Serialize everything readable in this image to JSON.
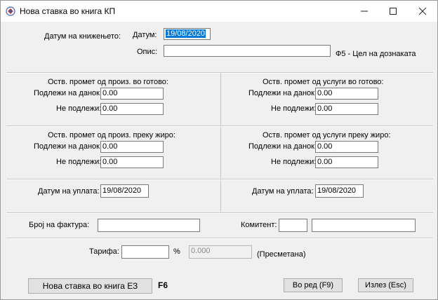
{
  "window": {
    "title": "Нова ставка во книга КП"
  },
  "header": {
    "booking_date_label": "Датум на книжењето:",
    "date_label": "Датум:",
    "date_value": "19/08/2020",
    "desc_label": "Опис:",
    "desc_value": "",
    "f5_hint": "Ф5 - Цел на дознаката"
  },
  "sections": {
    "prod_cash": {
      "title": "Оств. промет од произ. во готово:",
      "taxable_label": "Подлежи на данок:",
      "taxable_value": "0.00",
      "nontax_label": "Не подлежи:",
      "nontax_value": "0.00"
    },
    "serv_cash": {
      "title": "Оств. промет од услуги во готово:",
      "taxable_label": "Подлежи на данок:",
      "taxable_value": "0.00",
      "nontax_label": "Не подлежи:",
      "nontax_value": "0.00"
    },
    "prod_giro": {
      "title": "Оств. промет од произ. преку жиро:",
      "taxable_label": "Подлежи на данок:",
      "taxable_value": "0.00",
      "nontax_label": "Не подлежи:",
      "nontax_value": "0.00"
    },
    "serv_giro": {
      "title": "Оств. промет од услуги преку жиро:",
      "taxable_label": "Подлежи на данок:",
      "taxable_value": "0.00",
      "nontax_label": "Не подлежи:",
      "nontax_value": "0.00"
    }
  },
  "payment": {
    "left_label": "Датум на уплата:",
    "left_value": "19/08/2020",
    "right_label": "Датум на уплата:",
    "right_value": "19/08/2020"
  },
  "invoice": {
    "number_label": "Број на фактура:",
    "number_value": "",
    "client_label": "Комитент:",
    "client_code": "",
    "client_name": ""
  },
  "tariff": {
    "label": "Тарифа:",
    "value": "",
    "percent_sign": "%",
    "computed_value": "0.000",
    "computed_note": "(Пресметана)"
  },
  "buttons": {
    "new_entry": "Нова ставка во книга ЕЗ",
    "new_entry_shortcut": "F6",
    "ok": "Во ред (F9)",
    "exit": "Излез (Esc)"
  },
  "colors": {
    "selection": "#0078d7",
    "window_bg": "#f0f0f0"
  }
}
